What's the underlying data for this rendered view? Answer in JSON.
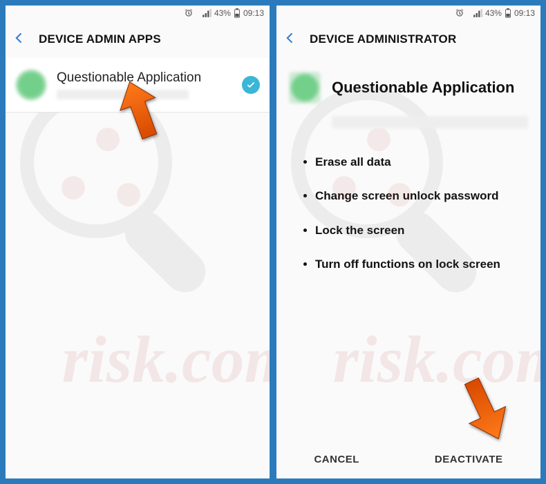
{
  "status": {
    "battery_pct": "43%",
    "clock": "09:13"
  },
  "left": {
    "title": "DEVICE ADMIN APPS",
    "item": {
      "title": "Questionable Application",
      "checked": true
    }
  },
  "right": {
    "title": "DEVICE ADMINISTRATOR",
    "app_title": "Questionable Application",
    "permissions": [
      "Erase all data",
      "Change screen unlock password",
      "Lock the screen",
      "Turn off functions on lock screen"
    ],
    "cancel": "CANCEL",
    "deactivate": "DEACTIVATE"
  },
  "watermark": "risk.com"
}
